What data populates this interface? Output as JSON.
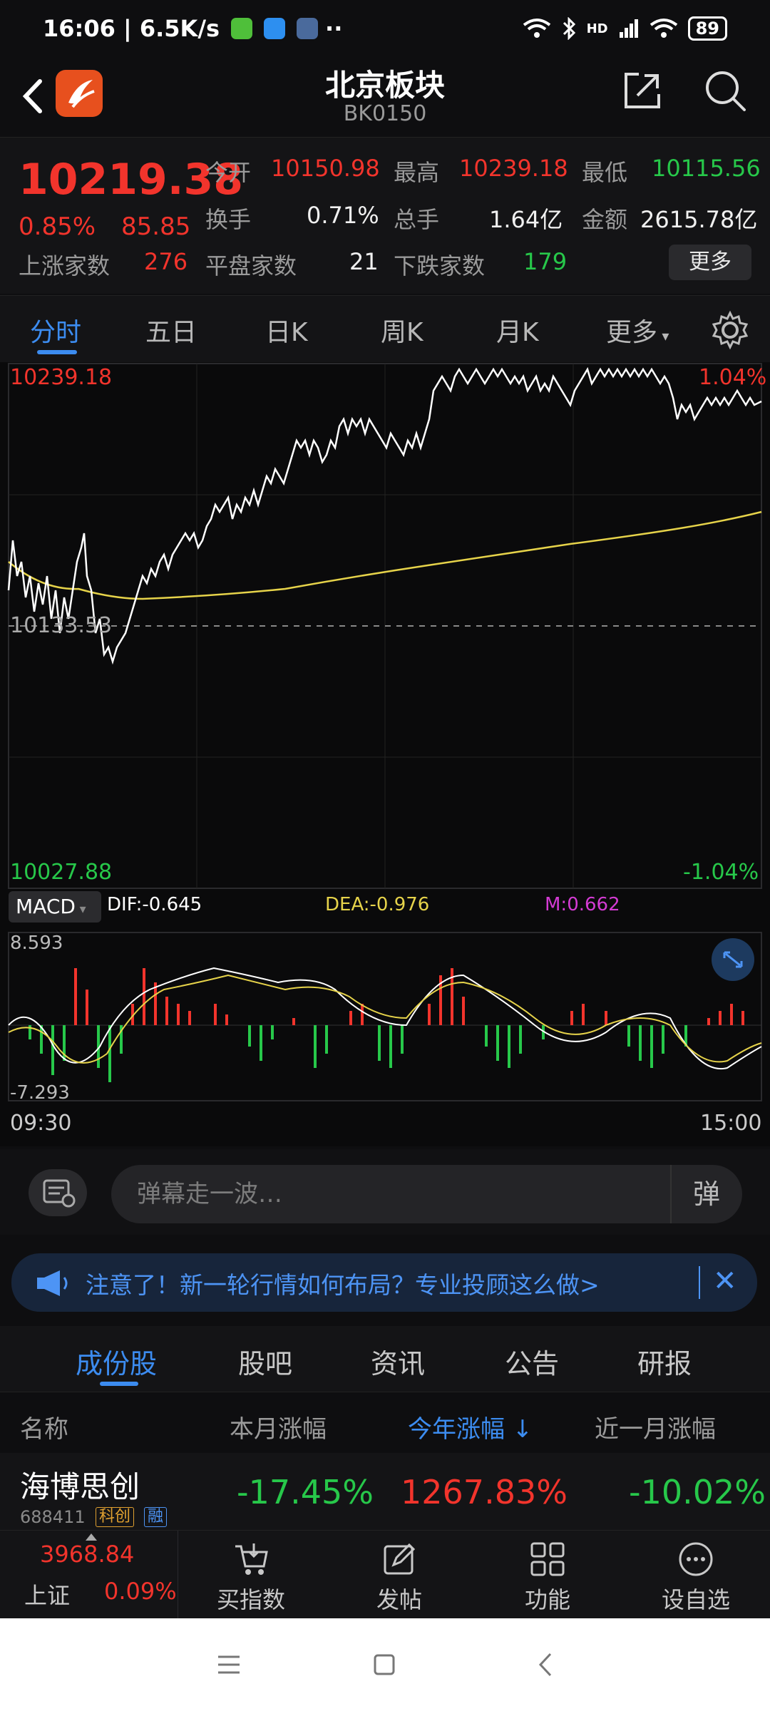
{
  "status_bar": {
    "time_speed": "16:06 | 6.5K/s",
    "more_dots": "··",
    "network_label": "HD",
    "battery": "89"
  },
  "header": {
    "title": "北京板块",
    "code": "BK0150"
  },
  "quote": {
    "price": "10219.38",
    "change_pct": "0.85%",
    "change_val": "85.85",
    "stats": [
      {
        "label": "今开",
        "value": "10150.98"
      },
      {
        "label": "最高",
        "value": "10239.18"
      },
      {
        "label": "最低",
        "value": "10115.56"
      },
      {
        "label": "换手",
        "value": "0.71%"
      },
      {
        "label": "总手",
        "value": "1.64亿"
      },
      {
        "label": "金额",
        "value": "2615.78亿"
      },
      {
        "label": "平盘家数",
        "value": "21"
      },
      {
        "label": "下跌家数",
        "value": "179"
      }
    ],
    "up_label": "上涨家数",
    "up_count": "276",
    "more_button": "更多"
  },
  "tabs": {
    "items": [
      "分时",
      "五日",
      "日K",
      "周K",
      "月K",
      "更多"
    ]
  },
  "chart": {
    "high_label": "10239.18",
    "high_pct": "1.04%",
    "mid_label": "10133.53",
    "low_label": "10027.88",
    "low_pct": "-1.04%",
    "macd_button": "MACD",
    "dif_label": "DIF:-0.645",
    "dea_label": "DEA:-0.976",
    "m_label": "M:0.662",
    "macd_max": "8.593",
    "macd_min": "-7.293",
    "time_start": "09:30",
    "time_end": "15:00",
    "colors": {
      "price_line": "#ffffff",
      "avg_line": "#e6d34a",
      "up": "#f2342c",
      "down": "#27c84a",
      "m": "#d33bd3"
    }
  },
  "danmu": {
    "placeholder": "弹幕走一波…",
    "button": "弹"
  },
  "notice": {
    "text": "注意了！新一轮行情如何布局？专业投顾这么做>"
  },
  "sub_tabs": {
    "items": [
      "成份股",
      "股吧",
      "资讯",
      "公告",
      "研报"
    ]
  },
  "table": {
    "headers": [
      "名称",
      "本月涨幅",
      "今年涨幅 ↓",
      "近一月涨幅"
    ],
    "rows": [
      {
        "name": "海博思创",
        "code": "688411",
        "badge1": "科创",
        "badge2": "融",
        "month": "-17.45%",
        "year": "1267.83%",
        "recent": "-10.02%"
      }
    ]
  },
  "bottom_nav": {
    "index_value": "3968.84",
    "index_name": "上证",
    "index_pct": "0.09%",
    "items": [
      "买指数",
      "发帖",
      "功能",
      "设自选"
    ]
  }
}
